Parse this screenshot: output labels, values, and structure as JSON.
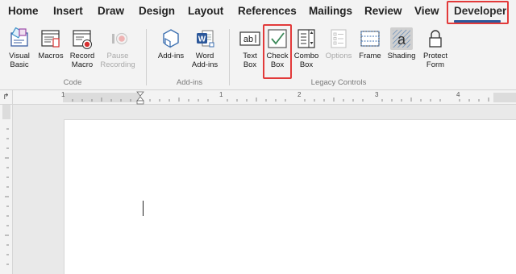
{
  "tabs": [
    "Home",
    "Insert",
    "Draw",
    "Design",
    "Layout",
    "References",
    "Mailings",
    "Review",
    "View",
    "Developer"
  ],
  "active_tab": "Developer",
  "groups": {
    "code": {
      "label": "Code",
      "buttons": [
        {
          "line1": "Visual",
          "line2": "Basic"
        },
        {
          "line1": "Macros",
          "line2": ""
        },
        {
          "line1": "Record",
          "line2": "Macro"
        },
        {
          "line1": "Pause",
          "line2": "Recording"
        }
      ]
    },
    "addins": {
      "label": "Add-ins",
      "buttons": [
        {
          "line1": "Add-ins",
          "line2": ""
        },
        {
          "line1": "Word",
          "line2": "Add-ins"
        }
      ]
    },
    "legacy": {
      "label": "Legacy Controls",
      "buttons": [
        {
          "line1": "Text",
          "line2": "Box"
        },
        {
          "line1": "Check",
          "line2": "Box"
        },
        {
          "line1": "Combo",
          "line2": "Box"
        },
        {
          "line1": "Options",
          "line2": ""
        },
        {
          "line1": "Frame",
          "line2": ""
        },
        {
          "line1": "Shading",
          "line2": ""
        },
        {
          "line1": "Protect",
          "line2": "Form"
        }
      ]
    }
  },
  "ruler": {
    "numbers": [
      "1",
      "1",
      "2",
      "3",
      "4"
    ],
    "corner_glyph": "↱"
  },
  "colors": {
    "highlight": "#e23a3a",
    "accent": "#2b579a",
    "check_green": "#3c8a5a"
  }
}
